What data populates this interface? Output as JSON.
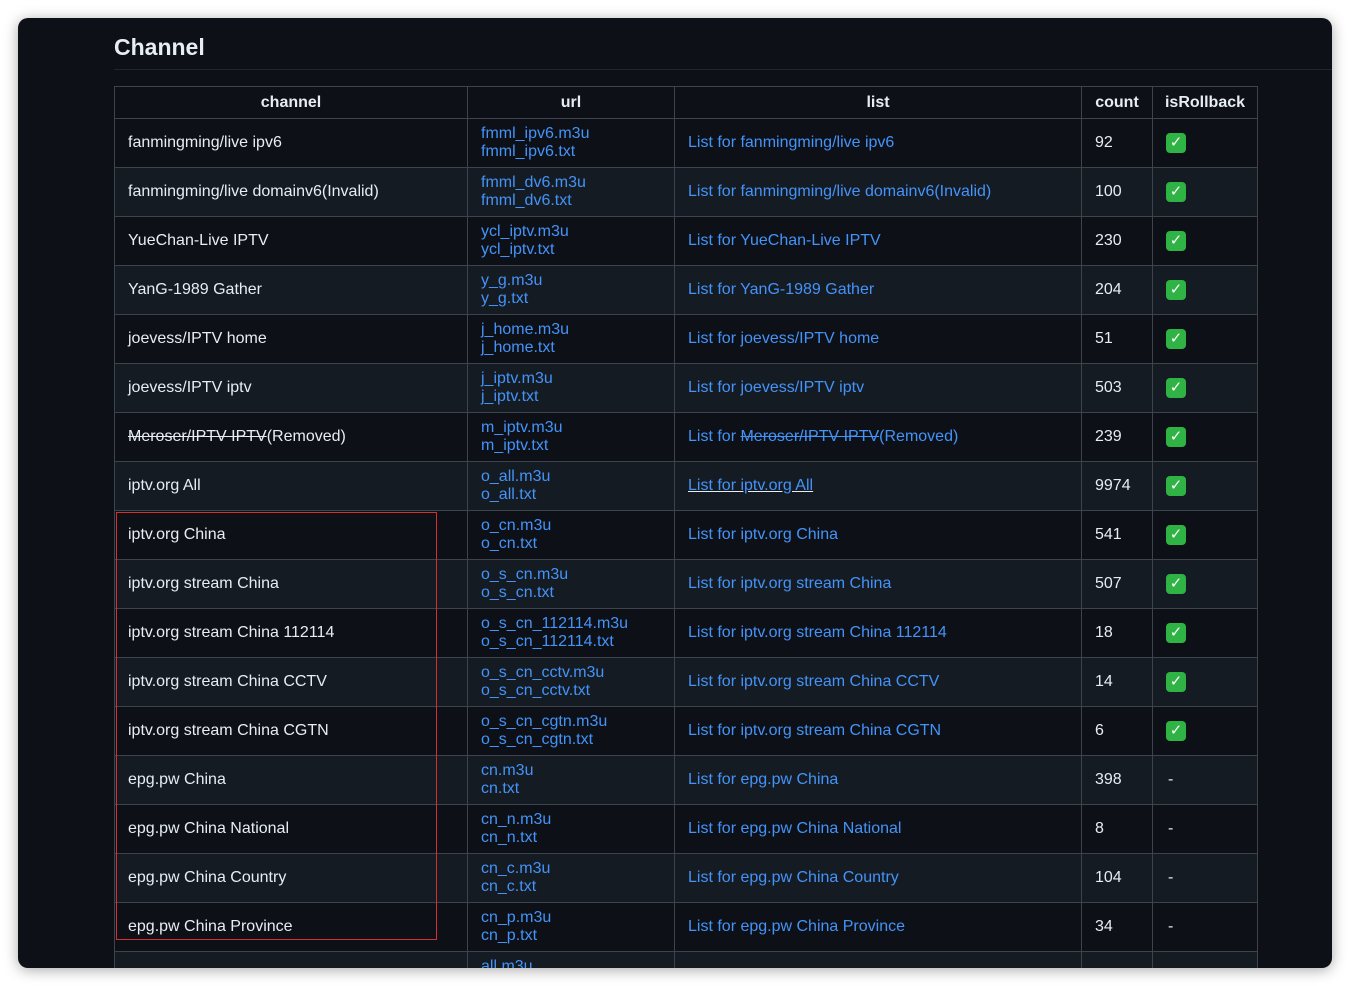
{
  "section_title": "Channel",
  "columns": {
    "channel": "channel",
    "url": "url",
    "list": "list",
    "count": "count",
    "isRollback": "isRollback"
  },
  "rollback_icon": "check-mark-icon",
  "colors": {
    "link": "#4493f8",
    "check": "#2fb344",
    "highlight": "#d72f2f"
  },
  "rows": [
    {
      "channel": "fanmingming/live ipv6",
      "url_m3u": "fmml_ipv6.m3u",
      "url_txt": "fmml_ipv6.txt",
      "list": "List for fanmingming/live ipv6",
      "count": "92",
      "rollback": true
    },
    {
      "channel": "fanmingming/live domainv6(Invalid)",
      "url_m3u": "fmml_dv6.m3u",
      "url_txt": "fmml_dv6.txt",
      "list": "List for fanmingming/live domainv6(Invalid)",
      "count": "100",
      "rollback": true
    },
    {
      "channel": "YueChan-Live IPTV",
      "url_m3u": "ycl_iptv.m3u",
      "url_txt": "ycl_iptv.txt",
      "list": "List for YueChan-Live IPTV",
      "count": "230",
      "rollback": true
    },
    {
      "channel": "YanG-1989 Gather",
      "url_m3u": "y_g.m3u",
      "url_txt": "y_g.txt",
      "list": "List for YanG-1989 Gather",
      "count": "204",
      "rollback": true
    },
    {
      "channel": "joevess/IPTV home",
      "url_m3u": "j_home.m3u",
      "url_txt": "j_home.txt",
      "list": "List for joevess/IPTV home",
      "count": "51",
      "rollback": true
    },
    {
      "channel": "joevess/IPTV iptv",
      "url_m3u": "j_iptv.m3u",
      "url_txt": "j_iptv.txt",
      "list": "List for joevess/IPTV iptv",
      "count": "503",
      "rollback": true
    },
    {
      "channel_struck": "Meroser/IPTV IPTV",
      "channel_suffix": "(Removed)",
      "url_m3u": "m_iptv.m3u",
      "url_txt": "m_iptv.txt",
      "list_prefix": "List for ",
      "list_struck": "Meroser/IPTV IPTV",
      "list_suffix": "(Removed)",
      "count": "239",
      "rollback": true
    },
    {
      "channel": "iptv.org All",
      "url_m3u": "o_all.m3u",
      "url_txt": "o_all.txt",
      "list": "List for iptv.org All",
      "count": "9974",
      "rollback": true
    },
    {
      "channel": "iptv.org China",
      "url_m3u": "o_cn.m3u",
      "url_txt": "o_cn.txt",
      "list": "List for iptv.org China",
      "count": "541",
      "rollback": true
    },
    {
      "channel": "iptv.org stream China",
      "url_m3u": "o_s_cn.m3u",
      "url_txt": "o_s_cn.txt",
      "list": "List for iptv.org stream China",
      "count": "507",
      "rollback": true
    },
    {
      "channel": "iptv.org stream China 112114",
      "url_m3u": "o_s_cn_112114.m3u",
      "url_txt": "o_s_cn_112114.txt",
      "list": "List for iptv.org stream China 112114",
      "count": "18",
      "rollback": true
    },
    {
      "channel": "iptv.org stream China CCTV",
      "url_m3u": "o_s_cn_cctv.m3u",
      "url_txt": "o_s_cn_cctv.txt",
      "list": "List for iptv.org stream China CCTV",
      "count": "14",
      "rollback": true
    },
    {
      "channel": "iptv.org stream China CGTN",
      "url_m3u": "o_s_cn_cgtn.m3u",
      "url_txt": "o_s_cn_cgtn.txt",
      "list": "List for iptv.org stream China CGTN",
      "count": "6",
      "rollback": true
    },
    {
      "channel": "epg.pw China",
      "url_m3u": "cn.m3u",
      "url_txt": "cn.txt",
      "list": "List for epg.pw China",
      "count": "398",
      "rollback": false,
      "rollback_text": "-"
    },
    {
      "channel": "epg.pw China National",
      "url_m3u": "cn_n.m3u",
      "url_txt": "cn_n.txt",
      "list": "List for epg.pw China National",
      "count": "8",
      "rollback": false,
      "rollback_text": "-"
    },
    {
      "channel": "epg.pw China Country",
      "url_m3u": "cn_c.m3u",
      "url_txt": "cn_c.txt",
      "list": "List for epg.pw China Country",
      "count": "104",
      "rollback": false,
      "rollback_text": "-"
    },
    {
      "channel": "epg.pw China Province",
      "url_m3u": "cn_p.m3u",
      "url_txt": "cn_p.txt",
      "list": "List for epg.pw China Province",
      "count": "34",
      "rollback": false,
      "rollback_text": "-"
    },
    {
      "channel": "",
      "url_m3u": "all.m3u",
      "url_txt": "",
      "list": "",
      "count": "",
      "rollback": null
    }
  ]
}
